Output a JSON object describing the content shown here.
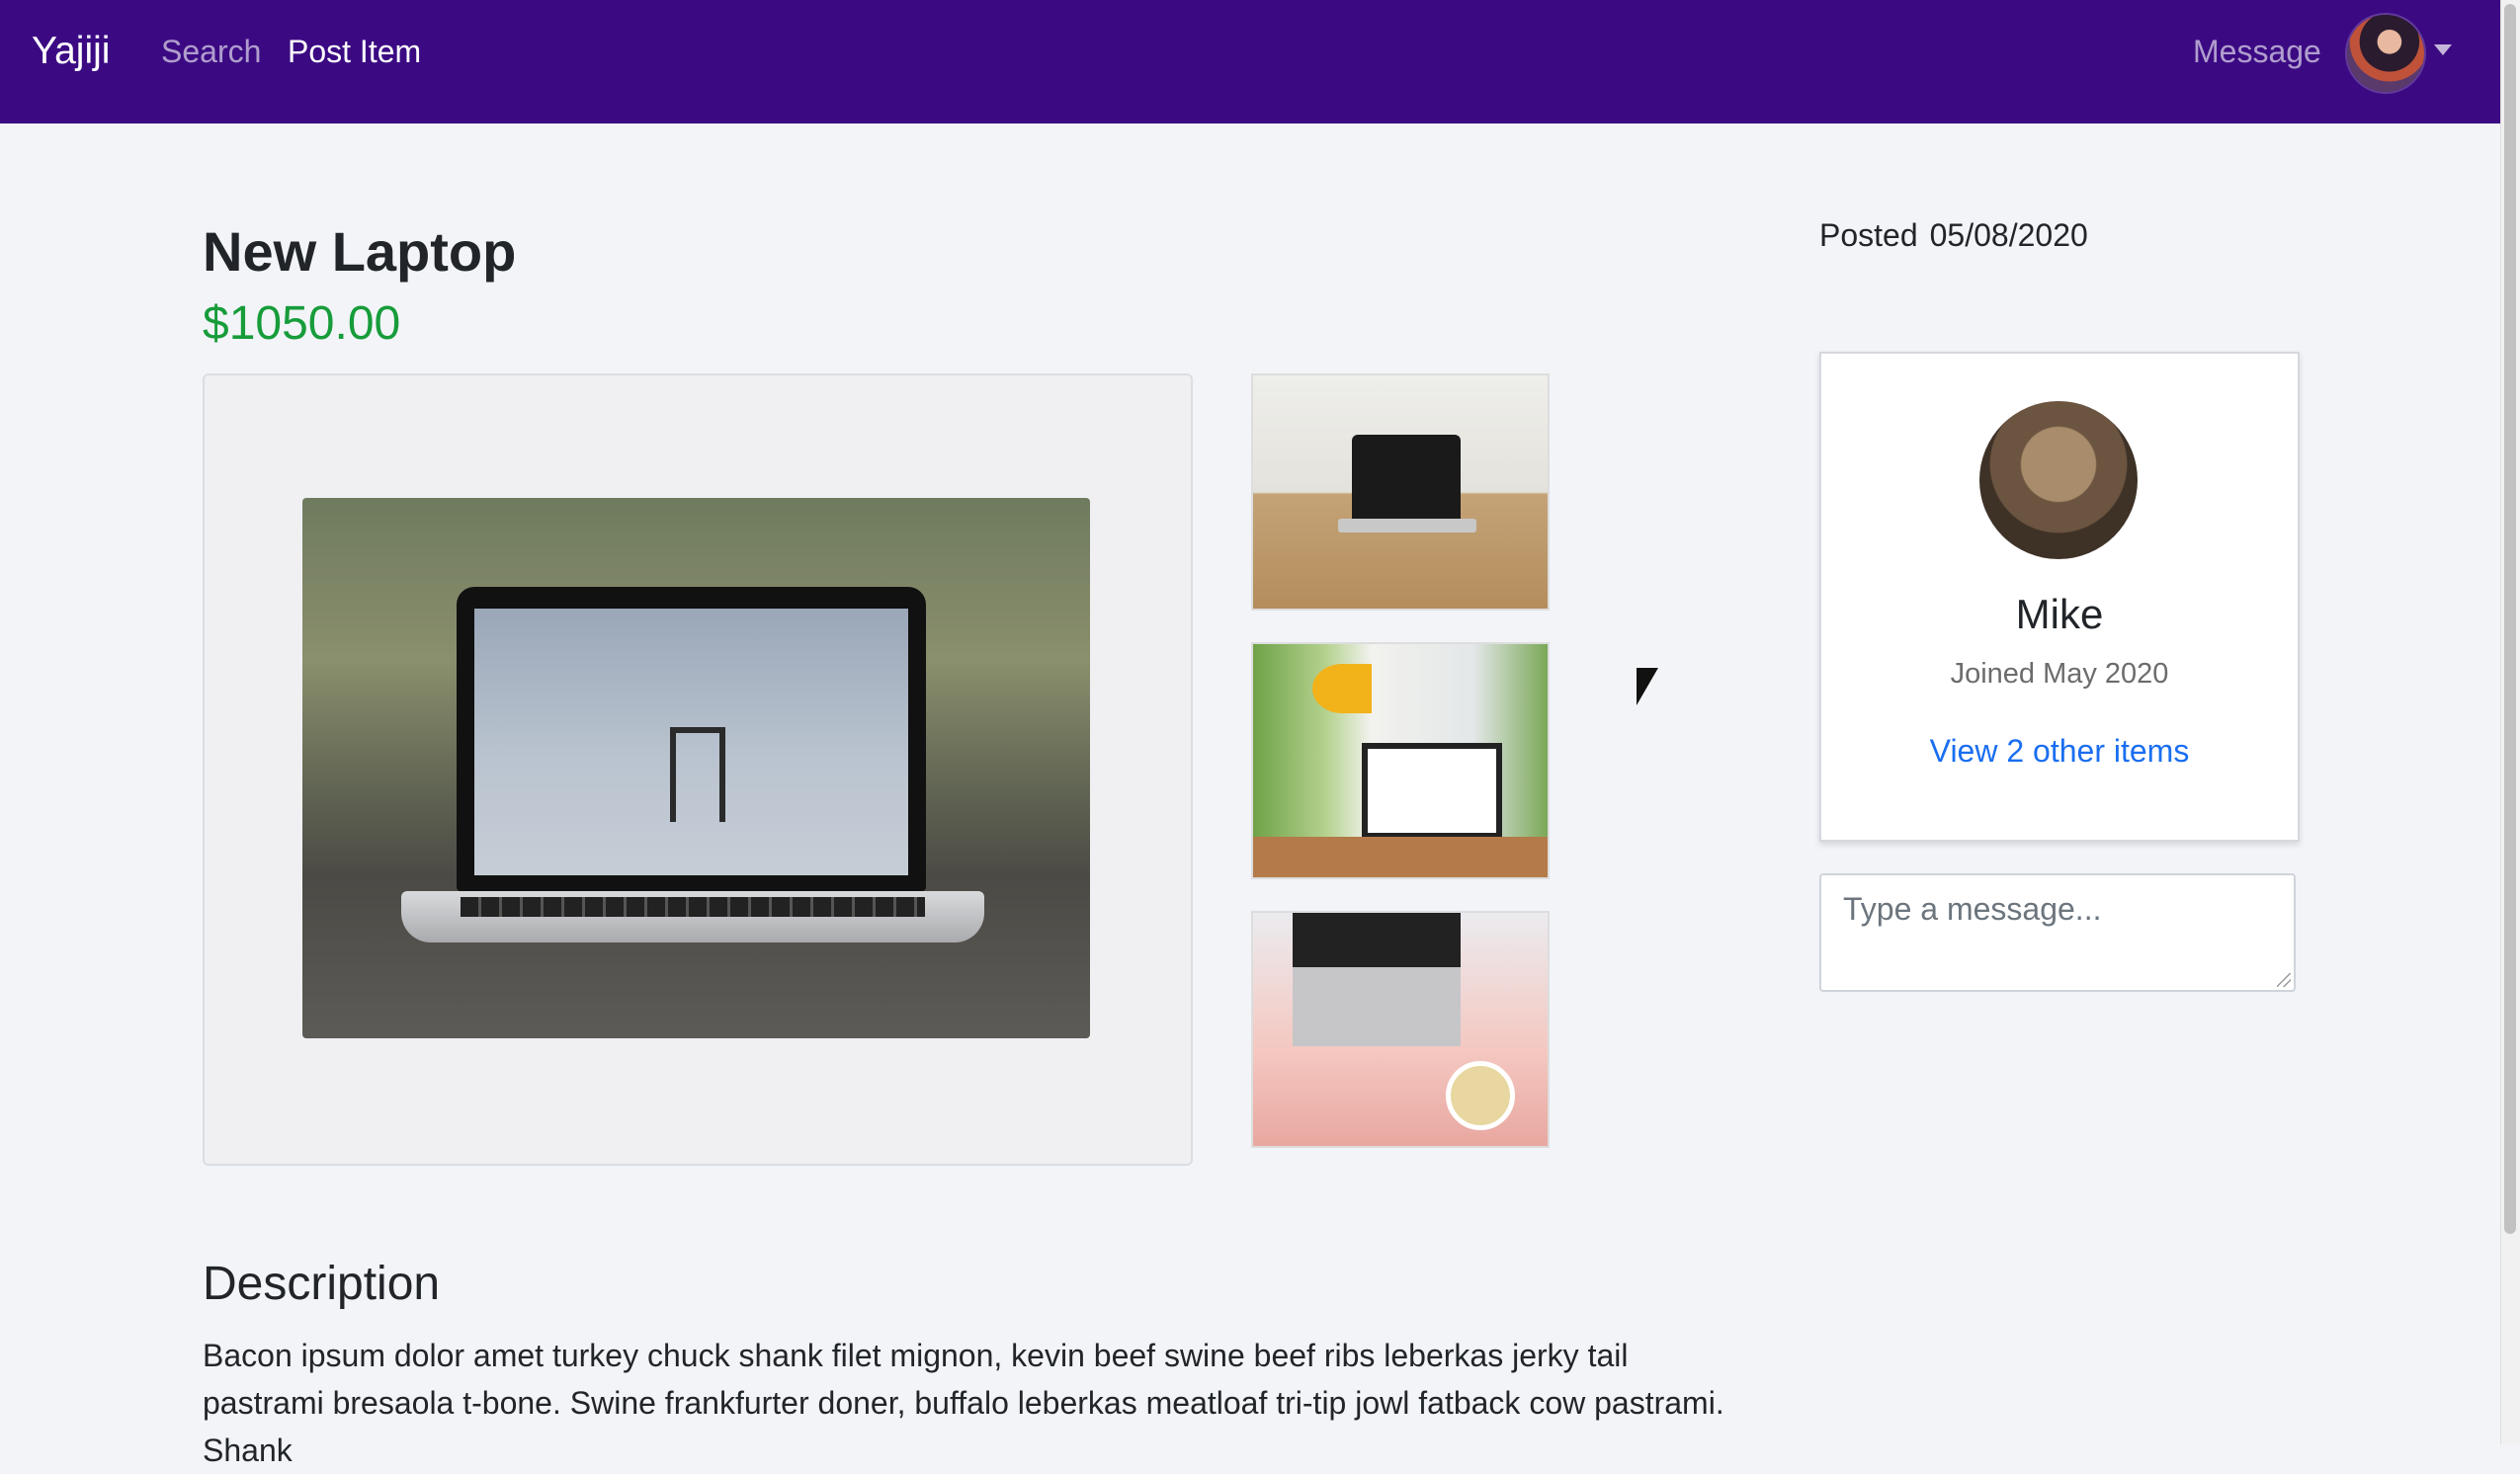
{
  "nav": {
    "brand": "Yajiji",
    "search": "Search",
    "post_item": "Post Item",
    "message": "Message",
    "avatar_icon": "user-avatar",
    "caret_icon": "caret-down-icon"
  },
  "listing": {
    "title": "New Laptop",
    "price": "$1050.00",
    "posted_label": "Posted",
    "posted_date": "05/08/2020"
  },
  "description": {
    "heading": "Description",
    "text": "Bacon ipsum dolor amet turkey chuck shank filet mignon, kevin beef swine beef ribs leberkas jerky tail pastrami bresaola t-bone. Swine frankfurter doner, buffalo leberkas meatloaf tri-tip jowl fatback cow pastrami. Shank"
  },
  "seller": {
    "name": "Mike",
    "joined": "Joined May 2020",
    "link": "View 2 other items"
  },
  "message_box": {
    "placeholder": "Type a message..."
  },
  "colors": {
    "navbar": "#3b0a83",
    "price": "#179c3a",
    "link": "#1a6ef0",
    "background": "#f2f4f8"
  }
}
